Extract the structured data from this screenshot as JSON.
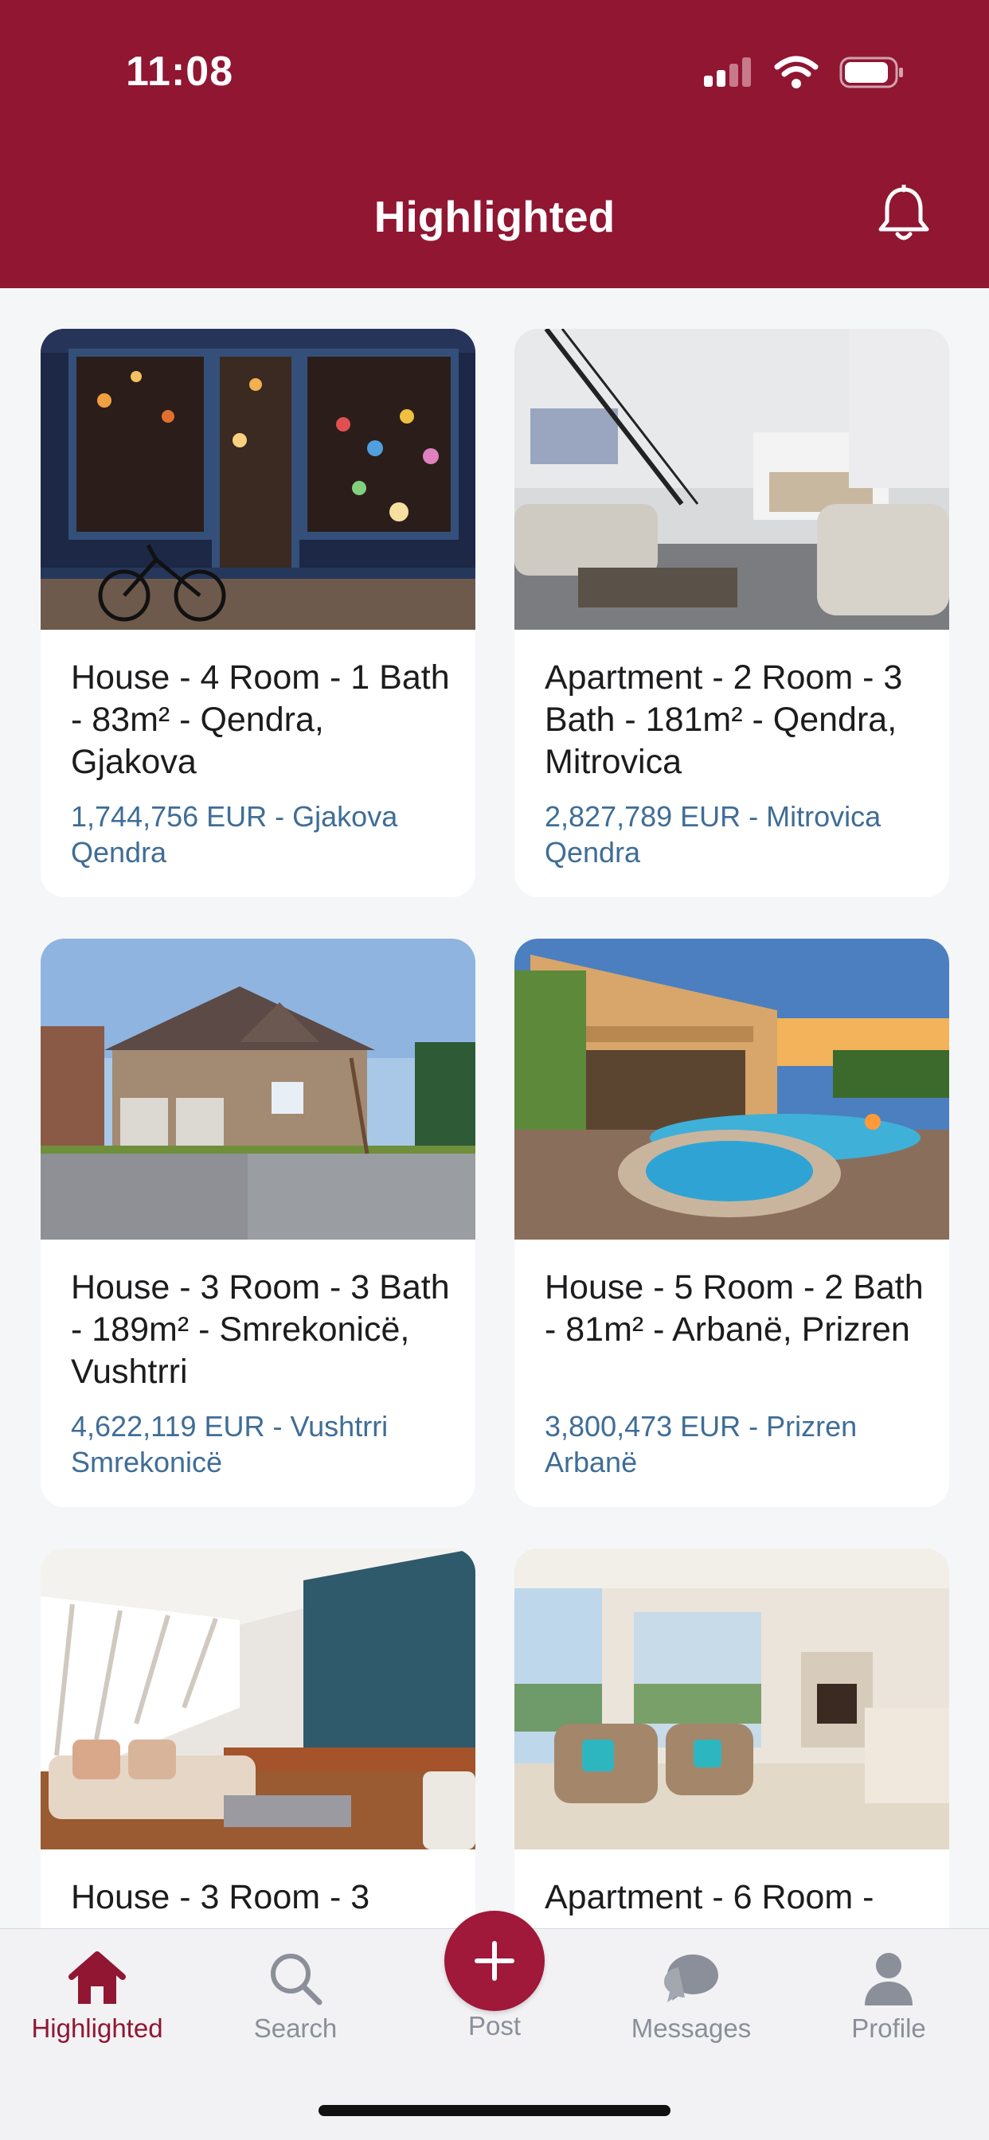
{
  "status_bar": {
    "time": "11:08"
  },
  "header": {
    "title": "Highlighted"
  },
  "listings": [
    {
      "title": "House - 4 Room - 1 Bath - 83m² - Qendra, Gjakova",
      "price": "1,744,756 EUR - Gjakova Qendra"
    },
    {
      "title": "Apartment - 2 Room - 3 Bath - 181m² - Qendra, Mitrovica",
      "price": "2,827,789 EUR - Mitrovica Qendra"
    },
    {
      "title": "House - 3 Room - 3 Bath - 189m² - Smrekonicë, Vushtrri",
      "price": "4,622,119 EUR - Vushtrri Smrekonicë"
    },
    {
      "title": "House - 5 Room - 2 Bath - 81m² - Arbanë, Prizren",
      "price": "3,800,473 EUR - Prizren Arbanë"
    },
    {
      "title": "House - 3 Room - 3"
    },
    {
      "title": "Apartment - 6 Room -"
    }
  ],
  "tabs": {
    "highlighted": "Highlighted",
    "search": "Search",
    "post": "Post",
    "messages": "Messages",
    "profile": "Profile"
  },
  "colors": {
    "brand": "#901632",
    "price": "#3f6d96",
    "tab_inactive": "#8a8f99"
  }
}
